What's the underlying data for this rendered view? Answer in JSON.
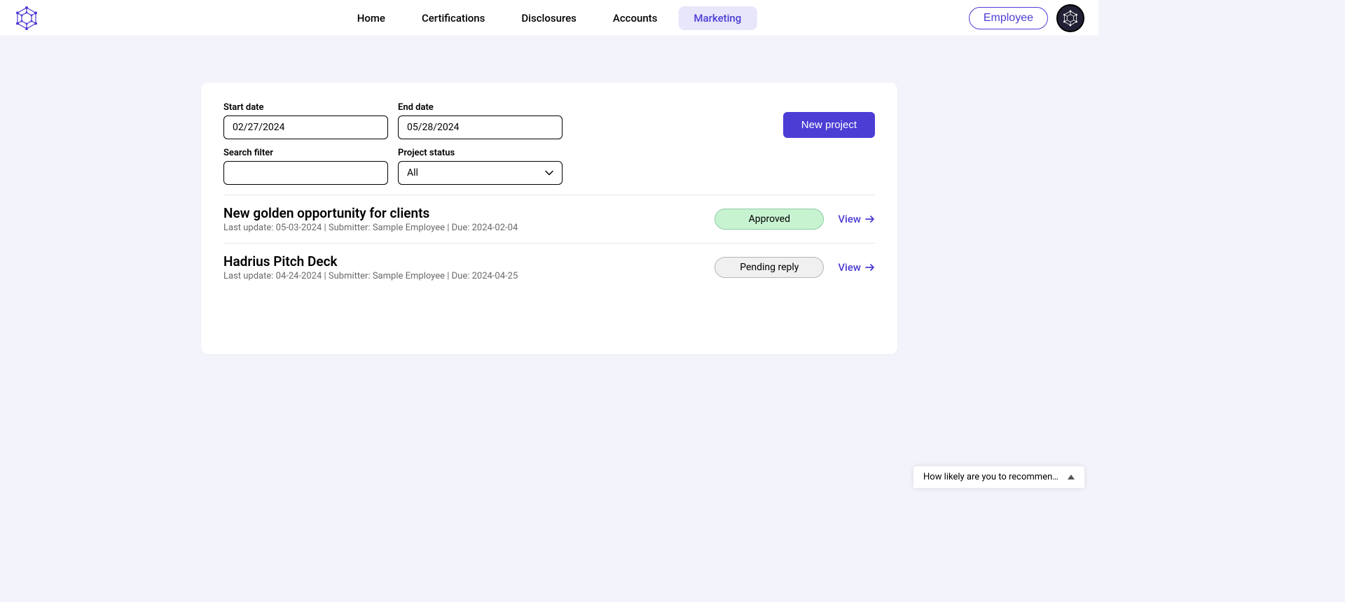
{
  "header": {
    "nav": [
      {
        "label": "Home",
        "active": false
      },
      {
        "label": "Certifications",
        "active": false
      },
      {
        "label": "Disclosures",
        "active": false
      },
      {
        "label": "Accounts",
        "active": false
      },
      {
        "label": "Marketing",
        "active": true
      }
    ],
    "employee_label": "Employee"
  },
  "filters": {
    "start_date": {
      "label": "Start date",
      "value": "02/27/2024"
    },
    "end_date": {
      "label": "End date",
      "value": "05/28/2024"
    },
    "search": {
      "label": "Search filter",
      "value": ""
    },
    "status": {
      "label": "Project status",
      "value": "All"
    }
  },
  "new_project_label": "New project",
  "projects": [
    {
      "title": "New golden opportunity for clients",
      "meta": "Last update: 05-03-2024 | Submitter: Sample Employee | Due: 2024-02-04",
      "status": "Approved",
      "status_class": "status-approved",
      "view_label": "View"
    },
    {
      "title": "Hadrius Pitch Deck",
      "meta": "Last update: 04-24-2024 | Submitter: Sample Employee | Due: 2024-04-25",
      "status": "Pending reply",
      "status_class": "status-pending",
      "view_label": "View"
    }
  ],
  "feedback": {
    "text": "How likely are you to recommen…"
  }
}
